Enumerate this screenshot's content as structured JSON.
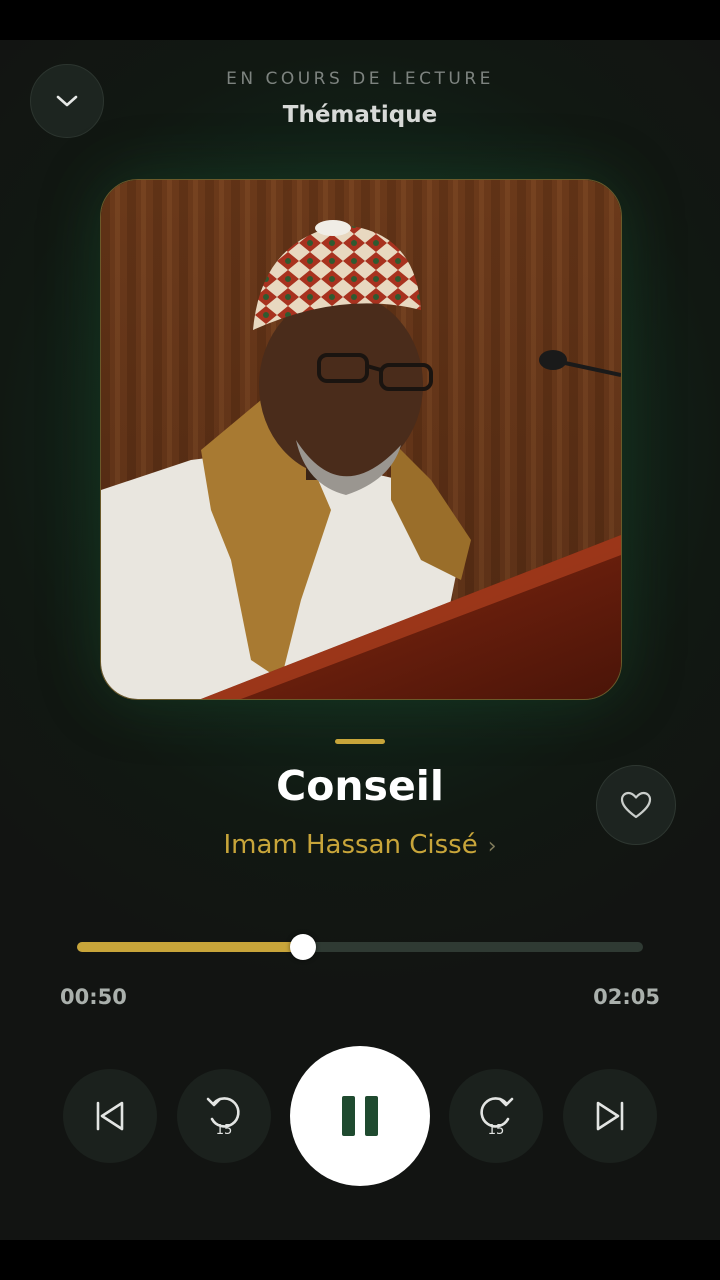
{
  "header": {
    "overline": "EN COURS DE LECTURE",
    "context": "Thématique"
  },
  "track": {
    "title": "Conseil",
    "artist": "Imam Hassan Cissé",
    "artist_chevron": "›",
    "liked": false
  },
  "playback": {
    "elapsed": "00:50",
    "duration": "02:05",
    "progress": 0.4,
    "state": "playing",
    "skip_back_seconds": "15",
    "skip_forward_seconds": "15"
  },
  "colors": {
    "accent": "#c8a53a",
    "background": "#12271b",
    "play_icon": "#1f4a2f"
  },
  "icons": {
    "collapse": "chevron-down-icon",
    "like": "heart-outline-icon",
    "previous": "skip-previous-icon",
    "rewind": "rewind-15-icon",
    "play_pause": "pause-icon",
    "forward": "forward-15-icon",
    "next": "skip-next-icon"
  }
}
